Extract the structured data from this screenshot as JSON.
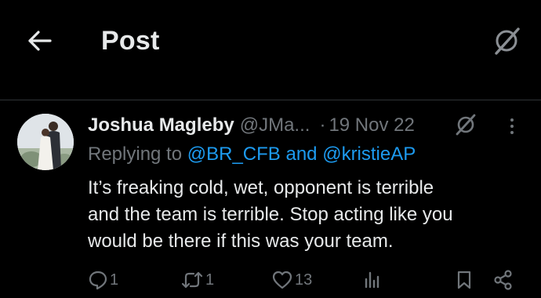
{
  "header": {
    "title": "Post",
    "back_icon": "back-arrow-icon",
    "grok_icon": "grok-icon"
  },
  "tweet": {
    "display_name": "Joshua Magleby",
    "handle": "@JMa...",
    "separator": "·",
    "date": "19 Nov 22",
    "replying_prefix": "Replying to",
    "reply_mention_1": "@BR_CFB",
    "reply_and": "and",
    "reply_mention_2": "@kristieAP",
    "text_lines": [
      "It’s freaking cold, wet, opponent is terrible",
      "and the team is terrible. Stop acting like you",
      "would be there if this was your team."
    ],
    "stats": {
      "replies": "1",
      "reposts": "1",
      "likes": "13"
    }
  },
  "colors": {
    "background": "#000000",
    "text": "#e7e9ea",
    "muted": "#71767b",
    "link": "#1d9bf0",
    "divider": "#2f3336"
  }
}
